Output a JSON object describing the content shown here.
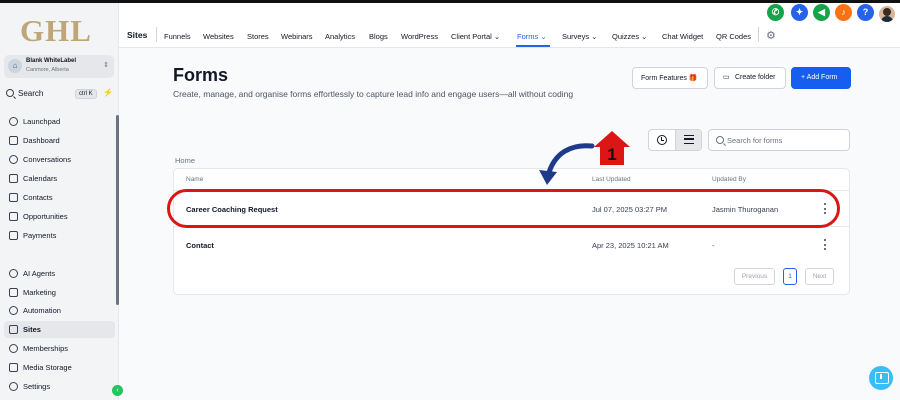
{
  "app": {
    "logo": "GHL"
  },
  "account": {
    "avatar": "⌂",
    "name": "Blank WhiteLabel",
    "location": "Canmore, Alberta"
  },
  "sidebar_search": {
    "label": "Search",
    "shortcut": "ctrl K"
  },
  "sidebar": {
    "items": [
      {
        "label": "Launchpad",
        "icon": "rocket-icon"
      },
      {
        "label": "Dashboard",
        "icon": "dashboard-icon"
      },
      {
        "label": "Conversations",
        "icon": "chat-icon"
      },
      {
        "label": "Calendars",
        "icon": "calendar-icon"
      },
      {
        "label": "Contacts",
        "icon": "contacts-icon"
      },
      {
        "label": "Opportunities",
        "icon": "opportunities-icon"
      },
      {
        "label": "Payments",
        "icon": "payments-icon"
      },
      {
        "label": "AI Agents",
        "icon": "sparkle-icon"
      },
      {
        "label": "Marketing",
        "icon": "send-icon"
      },
      {
        "label": "Automation",
        "icon": "automation-icon"
      },
      {
        "label": "Sites",
        "icon": "sites-icon",
        "active": true
      },
      {
        "label": "Memberships",
        "icon": "membership-icon"
      },
      {
        "label": "Media Storage",
        "icon": "media-icon"
      },
      {
        "label": "Settings",
        "icon": "gear-icon"
      }
    ]
  },
  "topnav": {
    "title": "Sites",
    "items": [
      {
        "label": "Funnels"
      },
      {
        "label": "Websites"
      },
      {
        "label": "Stores"
      },
      {
        "label": "Webinars"
      },
      {
        "label": "Analytics"
      },
      {
        "label": "Blogs"
      },
      {
        "label": "WordPress"
      },
      {
        "label": "Client Portal ⌄"
      },
      {
        "label": "Forms ⌄",
        "active": true
      },
      {
        "label": "Surveys ⌄"
      },
      {
        "label": "Quizzes ⌄"
      },
      {
        "label": "Chat Widget"
      },
      {
        "label": "QR Codes"
      }
    ]
  },
  "header_icons": [
    {
      "name": "phone-icon",
      "glyph": "✆",
      "color": "#16a34a"
    },
    {
      "name": "bolt-icon",
      "glyph": "✦",
      "color": "#2563eb"
    },
    {
      "name": "megaphone-icon",
      "glyph": "◀",
      "color": "#16a34a"
    },
    {
      "name": "bell-icon",
      "glyph": "♪",
      "color": "#f97316"
    },
    {
      "name": "help-icon",
      "glyph": "?",
      "color": "#2563eb"
    }
  ],
  "page": {
    "title": "Forms",
    "description": "Create, manage, and organise forms effortlessly to capture lead info and engage users—all without coding"
  },
  "actions": {
    "form_features": "Form Features 🎁",
    "create_folder": "Create folder",
    "add_form": "+ Add Form"
  },
  "search": {
    "placeholder": "Search for forms"
  },
  "breadcrumb": "Home",
  "table": {
    "headers": {
      "name": "Name",
      "last_updated": "Last Updated",
      "updated_by": "Updated By"
    },
    "rows": [
      {
        "name": "Career Coaching Request",
        "last_updated": "Jul 07, 2025 03:27 PM",
        "updated_by": "Jasmin Thuroganan"
      },
      {
        "name": "Contact",
        "last_updated": "Apr 23, 2025 10:21 AM",
        "updated_by": "-"
      }
    ]
  },
  "pagination": {
    "previous": "Previous",
    "current": "1",
    "next": "Next"
  },
  "annotation": {
    "step_number": "1",
    "color": "#dc1515",
    "arrow_color": "#1e3a8a"
  }
}
